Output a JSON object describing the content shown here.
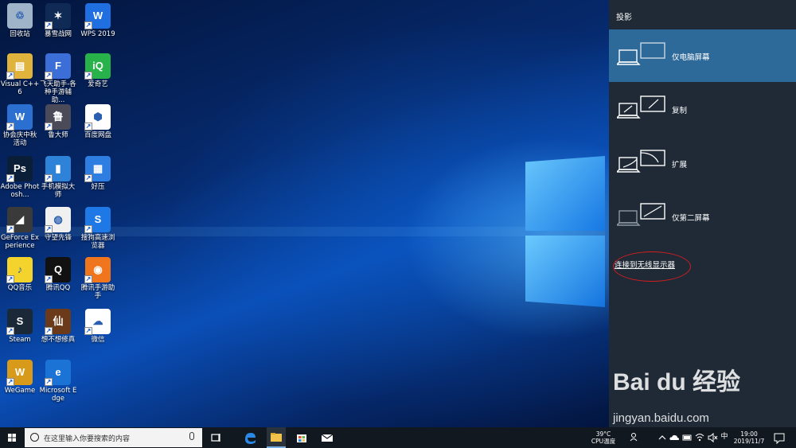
{
  "desktop": {
    "icons": [
      {
        "label": "回收站",
        "glyph": "♲",
        "color": "#9fb4c8"
      },
      {
        "label": "暴雪战网",
        "glyph": "✶",
        "color": "#0e2a55"
      },
      {
        "label": "WPS 2019",
        "glyph": "W",
        "color": "#1f6fe0"
      },
      {
        "label": "Visual C++ 6",
        "glyph": "▤",
        "color": "#e0b43c"
      },
      {
        "label": "飞天助手-各种手游辅助...",
        "glyph": "F",
        "color": "#3b6ed6"
      },
      {
        "label": "爱奇艺",
        "glyph": "iQ",
        "color": "#27b34a"
      },
      {
        "label": "协会庆中秋活动",
        "glyph": "W",
        "color": "#2b6fd1"
      },
      {
        "label": "鲁大师",
        "glyph": "鲁",
        "color": "#4a4a58"
      },
      {
        "label": "百度网盘",
        "glyph": "⬢",
        "color": "#ffffff"
      },
      {
        "label": "Adobe Photosh...",
        "glyph": "Ps",
        "color": "#0b1e38"
      },
      {
        "label": "手机模拟大师",
        "glyph": "▮",
        "color": "#2e82d8"
      },
      {
        "label": "好压",
        "glyph": "▦",
        "color": "#2e7de0"
      },
      {
        "label": "GeForce Experience",
        "glyph": "◢",
        "color": "#3a3a3a"
      },
      {
        "label": "守望先锋",
        "glyph": "◍",
        "color": "#f0f0f0"
      },
      {
        "label": "搜狗高速浏览器",
        "glyph": "S",
        "color": "#1e78e6"
      },
      {
        "label": "QQ音乐",
        "glyph": "♪",
        "color": "#f4d32c"
      },
      {
        "label": "腾讯QQ",
        "glyph": "Q",
        "color": "#111111"
      },
      {
        "label": "腾讯手游助手",
        "glyph": "◉",
        "color": "#f0761e"
      },
      {
        "label": "Steam",
        "glyph": "S",
        "color": "#1b2838"
      },
      {
        "label": "想不想修真",
        "glyph": "仙",
        "color": "#6a3a1a"
      },
      {
        "label": "微信",
        "glyph": "☁",
        "color": "#ffffff"
      },
      {
        "label": "WeGame",
        "glyph": "W",
        "color": "#d89a1a"
      },
      {
        "label": "Microsoft Edge",
        "glyph": "e",
        "color": "#1c73d6"
      }
    ]
  },
  "project_panel": {
    "title": "投影",
    "options": [
      {
        "label": "仅电脑屏幕",
        "selected": true
      },
      {
        "label": "复制",
        "selected": false
      },
      {
        "label": "扩展",
        "selected": false
      },
      {
        "label": "仅第二屏幕",
        "selected": false
      }
    ],
    "wireless_link": "连接到无线显示器"
  },
  "watermark": {
    "main": "Bai du 经验",
    "sub": "jingyan.baidu.com"
  },
  "taskbar": {
    "search_placeholder": "在这里输入你要搜索的内容",
    "cpu_temp": "39°C",
    "cpu_label": "CPU温度",
    "ime": "中",
    "time": "19:00",
    "date": "2019/11/7"
  },
  "colors": {
    "panel_bg": "#1f2a36",
    "selected_option": "#2d6a9a",
    "taskbar_bg": "#12181f",
    "annotation_red": "#d21e1e"
  }
}
